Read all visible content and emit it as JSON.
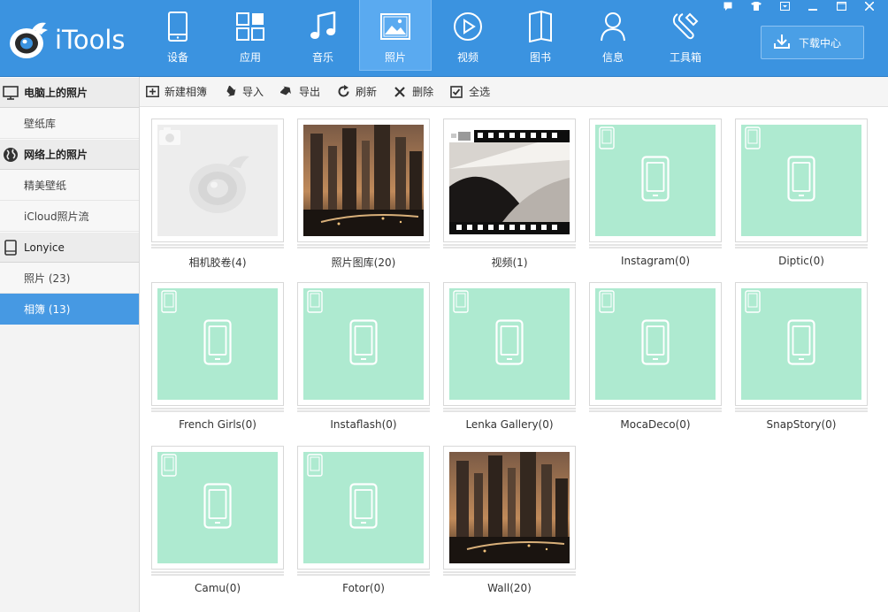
{
  "app": {
    "name": "iTools"
  },
  "nav": [
    {
      "label": "设备",
      "icon": "device-icon",
      "active": false
    },
    {
      "label": "应用",
      "icon": "apps-icon",
      "active": false
    },
    {
      "label": "音乐",
      "icon": "music-icon",
      "active": false
    },
    {
      "label": "照片",
      "icon": "photo-icon",
      "active": true
    },
    {
      "label": "视频",
      "icon": "video-icon",
      "active": false
    },
    {
      "label": "图书",
      "icon": "book-icon",
      "active": false
    },
    {
      "label": "信息",
      "icon": "contact-icon",
      "active": false
    },
    {
      "label": "工具箱",
      "icon": "toolbox-icon",
      "active": false
    }
  ],
  "download": {
    "label": "下载中心"
  },
  "sidebar": {
    "sections": [
      {
        "title": "电脑上的照片",
        "icon": "monitor-icon",
        "items": [
          {
            "label": "壁纸库",
            "active": false
          }
        ]
      },
      {
        "title": "网络上的照片",
        "icon": "globe-icon",
        "items": [
          {
            "label": "精美壁纸",
            "active": false
          },
          {
            "label": "iCloud照片流",
            "active": false
          }
        ]
      },
      {
        "title": "Lonyice",
        "icon": "phone-icon",
        "items": [
          {
            "label": "照片 (23)",
            "active": false
          },
          {
            "label": "相簿 (13)",
            "active": true
          }
        ]
      }
    ]
  },
  "toolbar": {
    "new_album": "新建相簿",
    "import": "导入",
    "export": "导出",
    "refresh": "刷新",
    "delete": "删除",
    "select_all": "全选"
  },
  "albums": [
    {
      "label": "相机胶卷(4)",
      "thumb": "camera-roll"
    },
    {
      "label": "照片图库(20)",
      "thumb": "city"
    },
    {
      "label": "视频(1)",
      "thumb": "video"
    },
    {
      "label": "Instagram(0)",
      "thumb": "empty"
    },
    {
      "label": "Diptic(0)",
      "thumb": "empty"
    },
    {
      "label": "French Girls(0)",
      "thumb": "empty"
    },
    {
      "label": "Instaflash(0)",
      "thumb": "empty"
    },
    {
      "label": "Lenka Gallery(0)",
      "thumb": "empty"
    },
    {
      "label": "MocaDeco(0)",
      "thumb": "empty"
    },
    {
      "label": "SnapStory(0)",
      "thumb": "empty"
    },
    {
      "label": "Camu(0)",
      "thumb": "empty"
    },
    {
      "label": "Fotor(0)",
      "thumb": "empty"
    },
    {
      "label": "Wall(20)",
      "thumb": "city"
    }
  ],
  "colors": {
    "header": "#3b93e0",
    "active_nav": "#5aaaf0",
    "sidebar_active": "#4699e3",
    "empty_album": "#aeead0"
  }
}
